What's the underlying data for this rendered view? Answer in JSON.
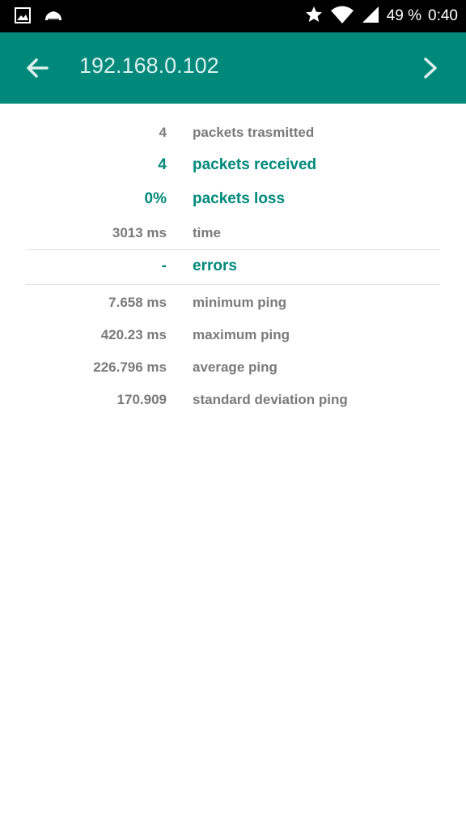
{
  "status_bar": {
    "battery": "49 %",
    "time": "0:40",
    "icons": [
      "image-icon",
      "cloud-icon",
      "star-icon",
      "wifi-icon",
      "signal-icon"
    ]
  },
  "app_bar": {
    "title": "192.168.0.102",
    "color": "#00897b",
    "back_icon": "arrow-left-icon",
    "next_icon": "chevron-right-icon"
  },
  "stats": {
    "transmitted": {
      "value": "4",
      "label": "packets trasmitted"
    },
    "received": {
      "value": "4",
      "label": "packets received"
    },
    "loss": {
      "value": "0%",
      "label": "packets loss"
    },
    "time": {
      "value": "3013 ms",
      "label": "time"
    },
    "errors": {
      "value": "-",
      "label": "errors"
    },
    "min": {
      "value": "7.658 ms",
      "label": "minimum ping"
    },
    "max": {
      "value": "420.23 ms",
      "label": "maximum ping"
    },
    "avg": {
      "value": "226.796 ms",
      "label": "average ping"
    },
    "mdev": {
      "value": "170.909",
      "label": "standard deviation ping"
    }
  },
  "colors": {
    "accent": "#00897b",
    "text": "#7a7a7a"
  }
}
